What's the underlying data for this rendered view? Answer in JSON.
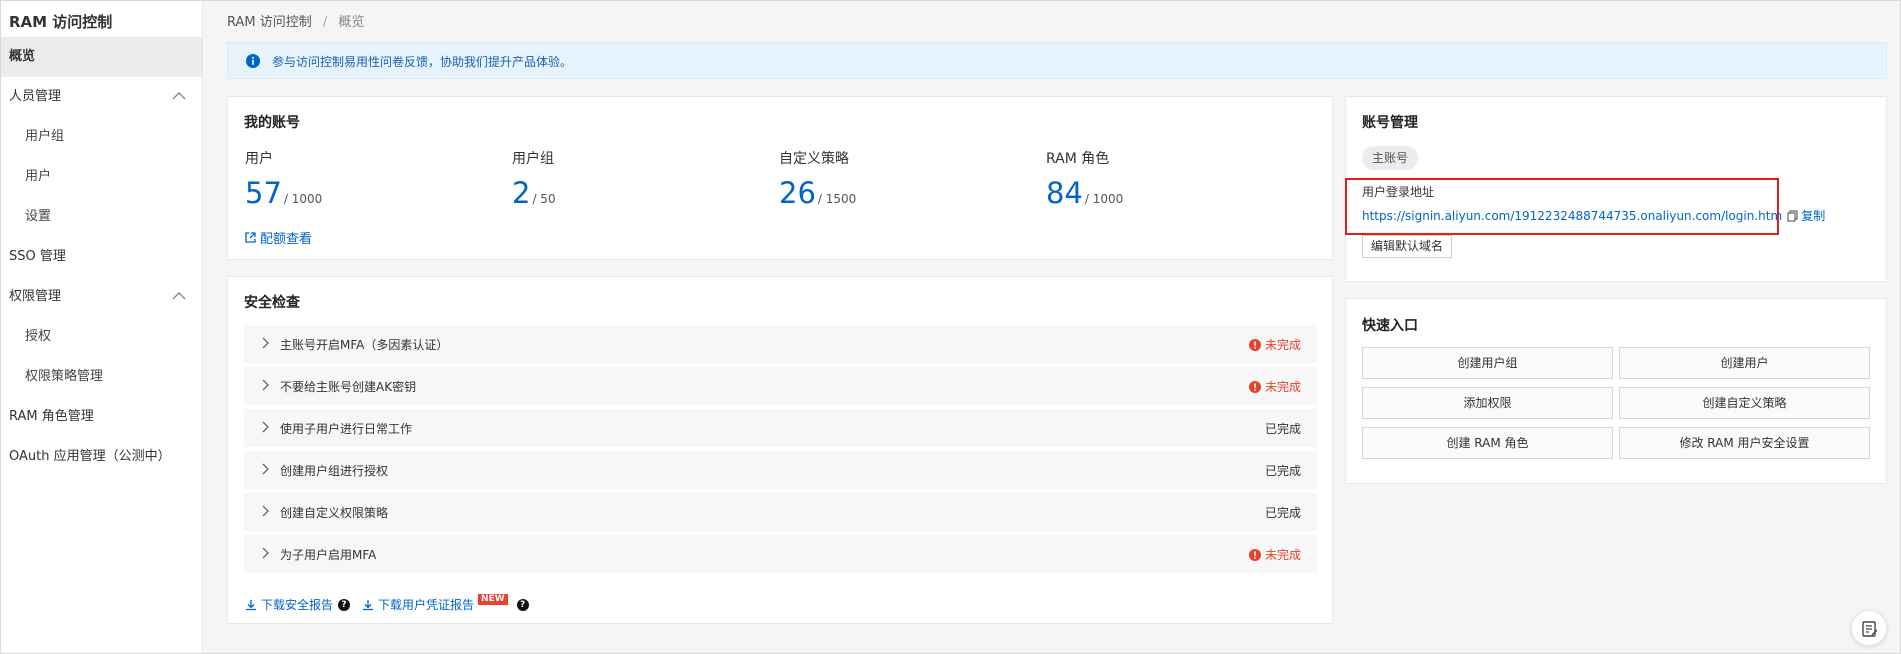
{
  "sidebar": {
    "title": "RAM 访问控制",
    "items": [
      {
        "label": "概览"
      },
      {
        "label": "人员管理"
      },
      {
        "label": "用户组"
      },
      {
        "label": "用户"
      },
      {
        "label": "设置"
      },
      {
        "label": "SSO 管理"
      },
      {
        "label": "权限管理"
      },
      {
        "label": "授权"
      },
      {
        "label": "权限策略管理"
      },
      {
        "label": "RAM 角色管理"
      },
      {
        "label": "OAuth 应用管理（公测中）"
      }
    ]
  },
  "breadcrumb": {
    "root": "RAM 访问控制",
    "sep": "/",
    "current": "概览"
  },
  "notice": {
    "text": "参与访问控制易用性问卷反馈，协助我们提升产品体验。"
  },
  "my_account": {
    "title": "我的账号",
    "stats": [
      {
        "label": "用户",
        "value": "57",
        "max": "/ 1000"
      },
      {
        "label": "用户组",
        "value": "2",
        "max": "/ 50"
      },
      {
        "label": "自定义策略",
        "value": "26",
        "max": "/ 1500"
      },
      {
        "label": "RAM 角色",
        "value": "84",
        "max": "/ 1000"
      }
    ],
    "quota_link": "配额查看"
  },
  "security": {
    "title": "安全检查",
    "rows": [
      {
        "label": "主账号开启MFA（多因素认证）",
        "status": "未完成",
        "done": false
      },
      {
        "label": "不要给主账号创建AK密钥",
        "status": "未完成",
        "done": false
      },
      {
        "label": "使用子用户进行日常工作",
        "status": "已完成",
        "done": true
      },
      {
        "label": "创建用户组进行授权",
        "status": "已完成",
        "done": true
      },
      {
        "label": "创建自定义权限策略",
        "status": "已完成",
        "done": true
      },
      {
        "label": "为子用户启用MFA",
        "status": "未完成",
        "done": false
      }
    ],
    "download_report": "下载安全报告",
    "download_credential": "下载用户凭证报告",
    "new_badge": "NEW",
    "help": "?"
  },
  "account_mgmt": {
    "title": "账号管理",
    "tag": "主账号",
    "login_label": "用户登录地址",
    "login_url": "https://signin.aliyun.com/1912232488744735.onaliyun.com/login.htm",
    "copy": "复制",
    "edit_button": "编辑默认域名"
  },
  "quick_entry": {
    "title": "快速入口",
    "buttons": [
      "创建用户组",
      "创建用户",
      "添加权限",
      "创建自定义策略",
      "创建 RAM 角色",
      "修改 RAM 用户安全设置"
    ]
  },
  "colors": {
    "accent": "#0064c8",
    "danger": "#e8412c",
    "notice_bg": "#e6f3fd",
    "highlight_border": "#e02020"
  }
}
